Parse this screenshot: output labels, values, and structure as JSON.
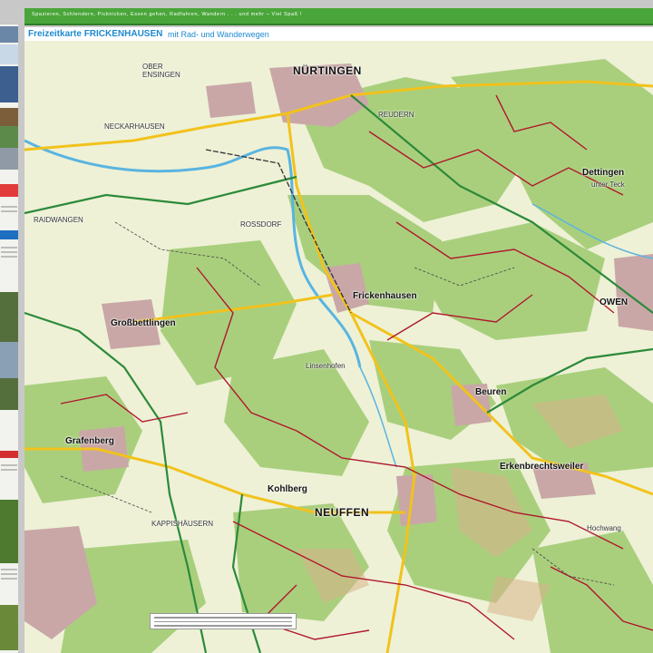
{
  "banner": {
    "text": "Spazieren, Schlendern, Picknicken, Essen gehen, Radfahren, Wandern . . . und mehr – Viel Spaß !"
  },
  "title": {
    "main": "Freizeitkarte FRICKENHAUSEN",
    "sub": "mit Rad- und Wanderwegen"
  },
  "places": {
    "nuertingen": "NÜRTINGEN",
    "ober_ensingen": "OBER ENSINGEN",
    "neckarhausen": "NECKARHAUSEN",
    "reudern": "REUDERN",
    "raidwangen": "RAIDWANGEN",
    "rossdorf": "ROSSDORF",
    "frickenhausen": "Frickenhausen",
    "grossbettlingen": "Großbettlingen",
    "dettingen": "Dettingen",
    "dettingen_sub": "unter Teck",
    "owen": "OWEN",
    "linsenhofen": "Linsenhofen",
    "beuren": "Beuren",
    "grafenberg": "Grafenberg",
    "kohlberg": "Kohlberg",
    "neuffen": "NEUFFEN",
    "erkenbrechtsweiler": "Erkenbrechtsweiler",
    "kappishaeusern": "KAPPISHÄUSERN",
    "hochwang": "Hochwang"
  },
  "colors": {
    "banner": "#4aa63a",
    "title": "#1e8ad0",
    "forest": "#a9cf7d",
    "field": "#eef1d6",
    "trail": "#b0172d",
    "river": "#5ab4e0",
    "road_yellow": "#f2c21c",
    "road_green": "#2c8a3a"
  }
}
